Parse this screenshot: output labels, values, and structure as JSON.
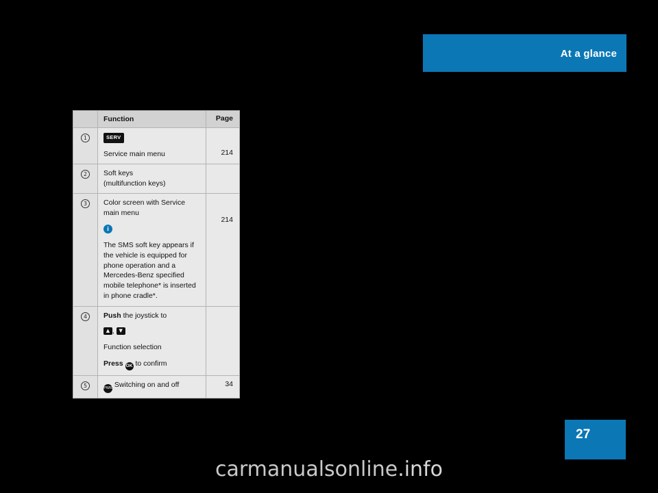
{
  "header": {
    "title": "At a glance"
  },
  "page_number": "27",
  "watermark": {
    "text": "carmanualsonline",
    "suffix": ".info"
  },
  "table": {
    "columns": {
      "number": "",
      "function": "Function",
      "page": "Page"
    },
    "rows": [
      {
        "number": "1",
        "badge": "SERV",
        "function": "Service main menu",
        "page": "214"
      },
      {
        "number": "2",
        "function_line1": "Soft keys",
        "function_line2": "(multifunction keys)",
        "page": ""
      },
      {
        "number": "3",
        "function_line1": "Color screen with Service",
        "function_line2": "main menu",
        "note_icon": "i",
        "note": "The SMS soft key appears if the vehicle is equipped for phone operation and a Mercedes-Benz specified mobile telephone* is inserted in phone cradle*.",
        "page": "214"
      },
      {
        "number": "4",
        "push_label": "Push",
        "push_rest": " the joystick to",
        "arrow_up": "▲",
        "arrow_down": "▼",
        "arrow_sep": ",",
        "selection": "Function selection",
        "press_label": "Press",
        "ok_key": "OK",
        "press_rest": " to confirm",
        "page": ""
      },
      {
        "number": "5",
        "power_key": "PWR",
        "function": "Switching on and off",
        "page": "34"
      }
    ]
  }
}
